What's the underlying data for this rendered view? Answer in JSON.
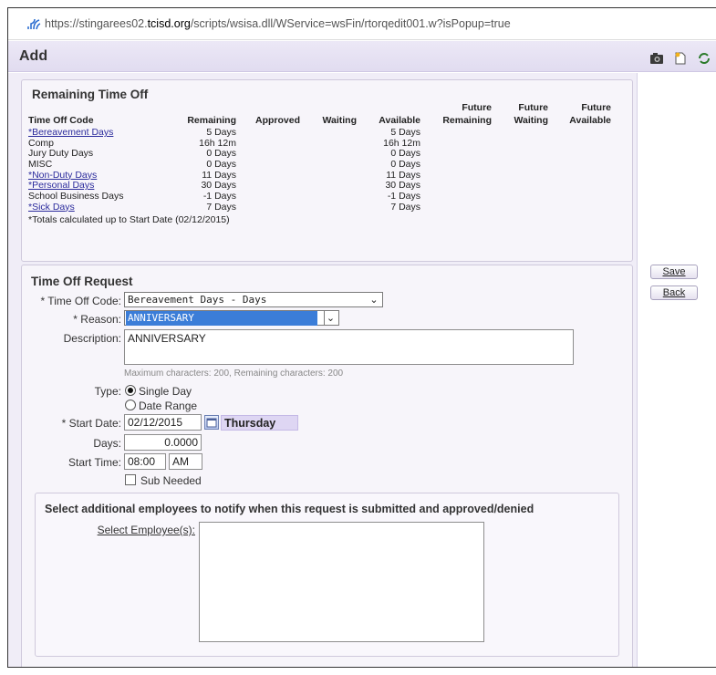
{
  "browser": {
    "url_prefix": "https://stingarees02.",
    "url_domain": "tcisd.org",
    "url_suffix": "/scripts/wsisa.dll/WService=wsFin/rtorqedit001.w?isPopup=true"
  },
  "dialog": {
    "title": "Add",
    "toolbar_icons": [
      "camera-icon",
      "new-document-icon",
      "refresh-icon"
    ]
  },
  "remaining": {
    "title": "Remaining Time Off",
    "headers": {
      "code": "Time Off Code",
      "remaining": "Remaining",
      "approved": "Approved",
      "waiting": "Waiting",
      "available": "Available",
      "future1": "Future",
      "future_remaining": "Remaining",
      "future2": "Future",
      "future_waiting": "Waiting",
      "future3": "Future",
      "future_available": "Available"
    },
    "rows": [
      {
        "code": "*Bereavement Days",
        "link": true,
        "remaining": "5 Days",
        "available": "5 Days"
      },
      {
        "code": "Comp",
        "link": false,
        "remaining": "16h 12m",
        "available": "16h 12m"
      },
      {
        "code": "Jury Duty Days",
        "link": false,
        "remaining": "0 Days",
        "available": "0 Days"
      },
      {
        "code": "MISC",
        "link": false,
        "remaining": "0 Days",
        "available": "0 Days"
      },
      {
        "code": "*Non-Duty Days",
        "link": true,
        "remaining": "11 Days",
        "available": "11 Days"
      },
      {
        "code": "*Personal Days",
        "link": true,
        "remaining": "30 Days",
        "available": "30 Days"
      },
      {
        "code": "School Business Days",
        "link": false,
        "remaining": "-1 Days",
        "available": "-1 Days"
      },
      {
        "code": "*Sick Days",
        "link": true,
        "remaining": "7 Days",
        "available": "7 Days"
      }
    ],
    "footnote": "*Totals calculated up to Start Date (02/12/2015)"
  },
  "request": {
    "title": "Time Off Request",
    "time_off_code_label": "* Time Off Code:",
    "time_off_code_value": "Bereavement Days - Days",
    "reason_label": "* Reason:",
    "reason_value": "ANNIVERSARY",
    "description_label": "Description:",
    "description_value": "ANNIVERSARY",
    "char_hint": "Maximum characters: 200, Remaining characters: 200",
    "type_label": "Type:",
    "type_single": "Single Day",
    "type_range": "Date Range",
    "start_date_label": "* Start Date:",
    "start_date_value": "02/12/2015",
    "weekday": "Thursday",
    "days_label": "Days:",
    "days_value": "0.0000",
    "start_time_label": "Start Time:",
    "start_time_value": "08:00",
    "ampm_value": "AM",
    "sub_needed_label": "Sub Needed"
  },
  "notify": {
    "title": "Select additional employees to notify when this request is submitted and approved/denied",
    "select_link": "Select Employee(s):"
  },
  "actions": {
    "save": "Save",
    "back": "Back"
  }
}
